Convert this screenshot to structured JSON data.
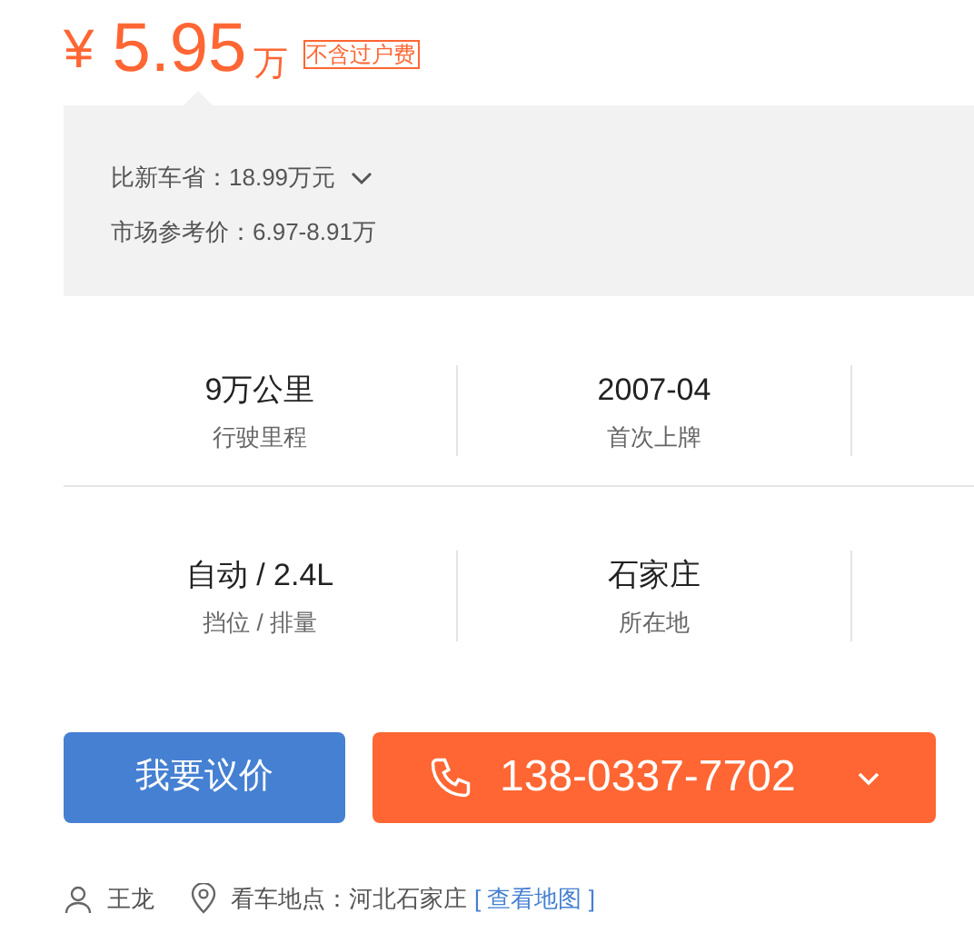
{
  "price": {
    "currency": "¥",
    "amount": "5.95",
    "unit": "万",
    "tag": "不含过户费"
  },
  "savings": {
    "label": "比新车省：18.99万元",
    "expanded": false,
    "reference": "市场参考价：6.97-8.91万"
  },
  "specs": [
    [
      {
        "value": "9万公里",
        "label": "行驶里程"
      },
      {
        "value": "2007-04",
        "label": "首次上牌"
      }
    ],
    [
      {
        "value": "自动 / 2.4L",
        "label": "挡位 / 排量"
      },
      {
        "value": "石家庄",
        "label": "所在地"
      }
    ]
  ],
  "buttons": {
    "negotiate": "我要议价",
    "phone": "138-0337-7702"
  },
  "seller": {
    "name": "王龙",
    "location": "看车地点：河北石家庄",
    "map_link": "[ 查看地图 ]"
  }
}
